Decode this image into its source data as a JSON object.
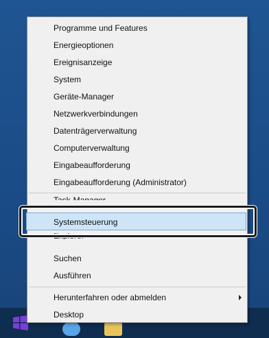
{
  "menu": {
    "items": [
      {
        "label": "Programme und Features"
      },
      {
        "label": "Energieoptionen"
      },
      {
        "label": "Ereignisanzeige"
      },
      {
        "label": "System"
      },
      {
        "label": "Geräte-Manager"
      },
      {
        "label": "Netzwerkverbindungen"
      },
      {
        "label": "Datenträgerverwaltung"
      },
      {
        "label": "Computerverwaltung"
      },
      {
        "label": "Eingabeaufforderung"
      },
      {
        "label": "Eingabeaufforderung (Administrator)"
      },
      {
        "label": "Task-Manager"
      },
      {
        "label": "Systemsteuerung"
      },
      {
        "label": "Explorer"
      },
      {
        "label": "Suchen"
      },
      {
        "label": "Ausführen"
      },
      {
        "label": "Herunterfahren oder abmelden"
      },
      {
        "label": "Desktop"
      }
    ]
  },
  "taskbar": {
    "start_icon": "windows-logo-icon",
    "app_icons": [
      "ie-icon",
      "explorer-icon"
    ]
  },
  "colors": {
    "menu_bg": "#f0f0f0",
    "highlight_bg": "#cde5f7",
    "highlight_border": "#7ea7d2",
    "desktop_bg": "#1f5592",
    "taskbar_bg": "#0f2d4f"
  }
}
